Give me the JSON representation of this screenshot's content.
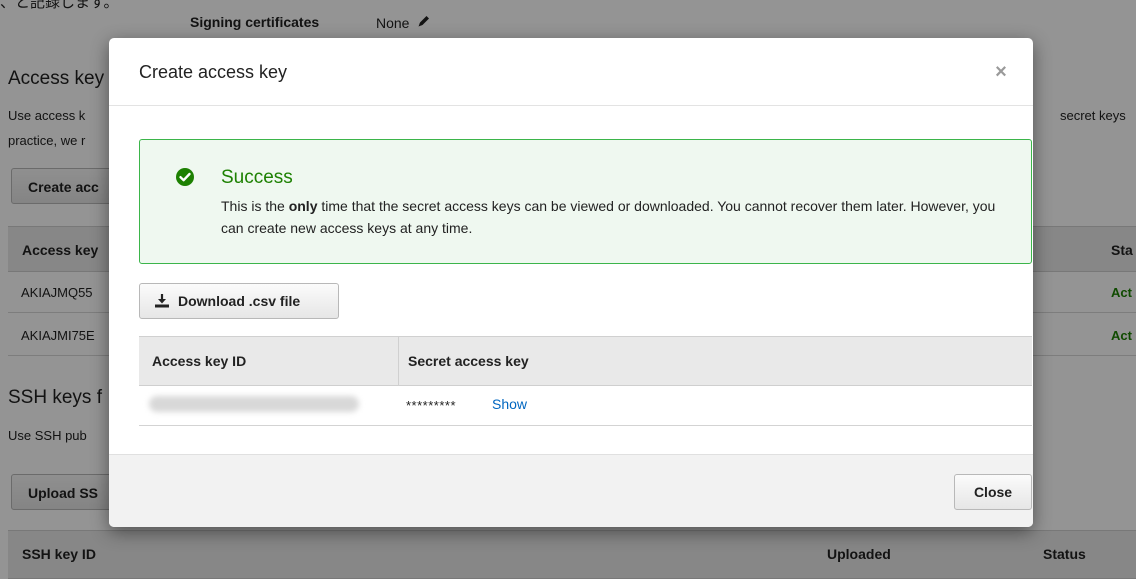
{
  "background": {
    "top_note": "、と記録します。",
    "signing_label": "Signing certificates",
    "signing_value": "None",
    "access_keys_heading": "Access key",
    "access_desc_line1": "Use access k",
    "access_desc_line1_right": "secret keys",
    "access_desc_line2": "practice, we r",
    "create_button": "Create acc",
    "table_header_col1": "Access key",
    "table_header_status": "Sta",
    "rows": [
      {
        "id": "AKIAJMQ55",
        "status": "Act"
      },
      {
        "id": "AKIAJMI75E",
        "status": "Act"
      }
    ],
    "ssh_heading": "SSH keys f",
    "ssh_desc": "Use SSH pub",
    "upload_button": "Upload SS",
    "ssh_header_id": "SSH key ID",
    "ssh_header_uploaded": "Uploaded",
    "ssh_header_status": "Status"
  },
  "modal": {
    "title": "Create access key",
    "close_icon": "×",
    "alert": {
      "title": "Success",
      "text_before": "This is the ",
      "text_bold": "only",
      "text_after": " time that the secret access keys can be viewed or downloaded. You cannot recover them later. However, you can create new access keys at any time."
    },
    "download_button": "Download .csv file",
    "table": {
      "col1": "Access key ID",
      "col2": "Secret access key",
      "secret_mask": "*********",
      "show_link": "Show"
    },
    "close_button": "Close"
  },
  "colors": {
    "success_green": "#1d8102",
    "alert_border": "#3bb54a",
    "alert_bg": "#eff8f0",
    "link_blue": "#0066c0",
    "status_green": "#1d8102"
  }
}
